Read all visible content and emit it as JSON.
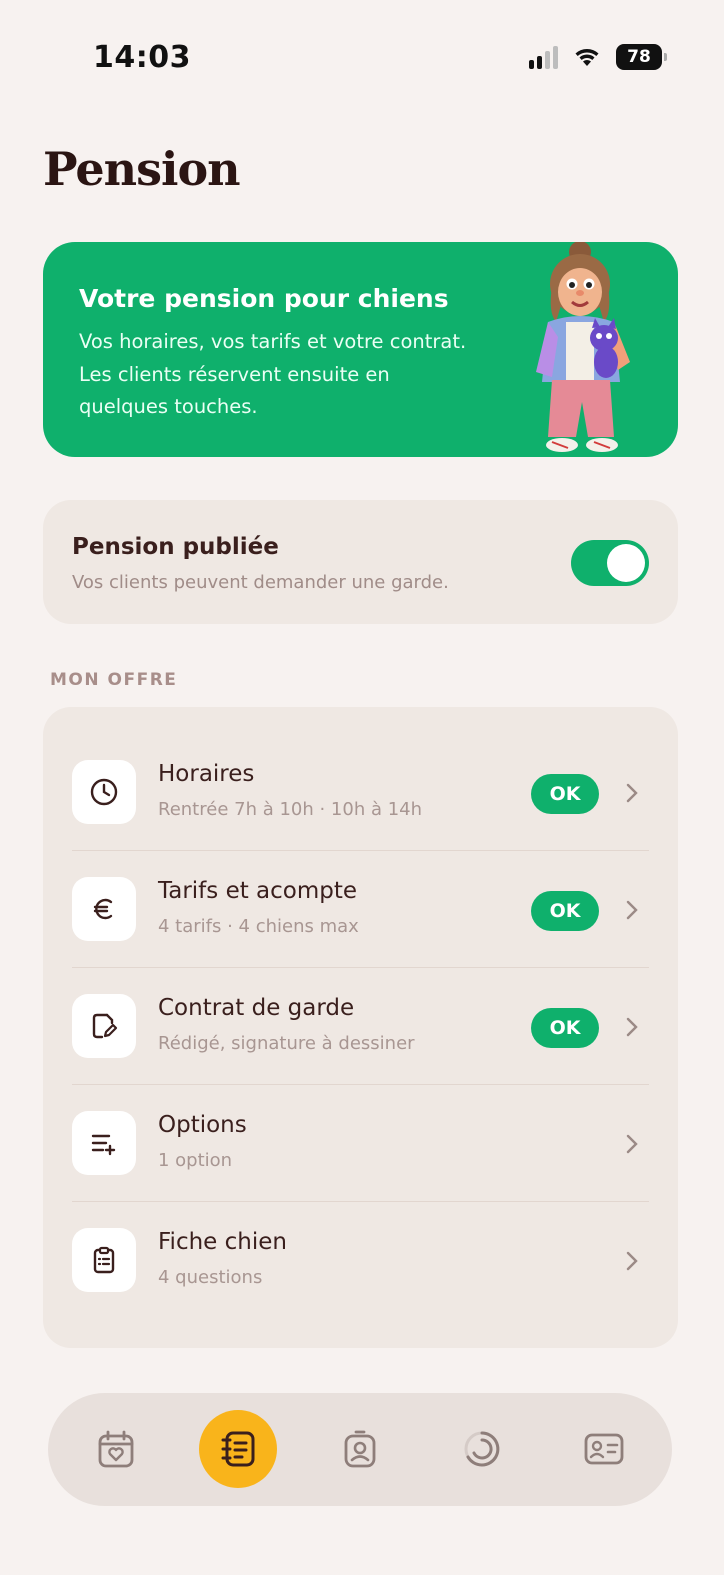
{
  "status_bar": {
    "time": "14:03",
    "battery": "78"
  },
  "page_title": "Pension",
  "hero": {
    "title": "Votre pension pour chiens",
    "text": "Vos horaires, vos tarifs et votre contrat. Les clients réservent ensuite en quelques touches.",
    "bg_color": "#0fb06c"
  },
  "publish": {
    "title": "Pension publiée",
    "subtitle": "Vos clients peuvent demander une garde.",
    "enabled": true
  },
  "section_label": "MON OFFRE",
  "offer_items": [
    {
      "title": "Horaires",
      "subtitle": "Rentrée 7h à 10h · 10h à 14h",
      "badge": "OK",
      "icon": "clock-icon"
    },
    {
      "title": "Tarifs et acompte",
      "subtitle": "4 tarifs · 4 chiens max",
      "badge": "OK",
      "icon": "euro-icon"
    },
    {
      "title": "Contrat de garde",
      "subtitle": "Rédigé, signature à dessiner",
      "badge": "OK",
      "icon": "contract-pen-icon"
    },
    {
      "title": "Options",
      "subtitle": "1 option",
      "badge": "",
      "icon": "list-add-icon"
    },
    {
      "title": "Fiche chien",
      "subtitle": "4 questions",
      "badge": "",
      "icon": "clipboard-icon"
    }
  ],
  "tabs": [
    {
      "icon": "calendar-heart-icon",
      "active": false
    },
    {
      "icon": "notebook-icon",
      "active": true
    },
    {
      "icon": "badge-person-icon",
      "active": false
    },
    {
      "icon": "progress-ring-icon",
      "active": false
    },
    {
      "icon": "id-card-icon",
      "active": false
    }
  ],
  "colors": {
    "accent_green": "#0fb06c",
    "active_tab": "#f9b41b",
    "background": "#f7f2f0"
  }
}
